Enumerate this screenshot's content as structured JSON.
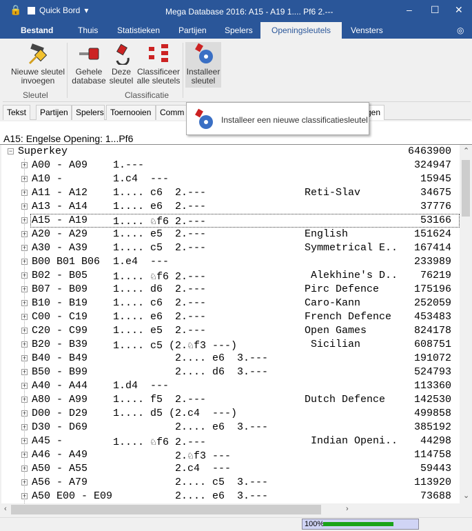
{
  "titlebar": {
    "quick_board": "Quick Bord",
    "title": "Mega Database 2016:  A15 - A19    1.... Pf6 2.---"
  },
  "ribbon_tabs": [
    "Bestand",
    "Thuis",
    "Statistieken",
    "Partijen",
    "Spelers",
    "Openingsleutels",
    "Vensters"
  ],
  "ribbon": {
    "new_key": "Nieuwe sleutel invoegen",
    "group_key": "Sleutel",
    "whole_db": "Gehele database",
    "this_key": "Deze sleutel",
    "classify_all": "Classificeer alle sleutels",
    "install_key": "Installeer sleutel",
    "group_class": "Classificatie"
  },
  "doc_tabs": [
    "Tekst",
    "Partijen",
    "Spelers",
    "Toernooien",
    "Comm",
    "gen"
  ],
  "tooltip": "Installeer een nieuwe classificatiesleutel",
  "heading": "A15: Engelse Opening: 1...Pf6",
  "tree": {
    "root": {
      "label": "Superkey",
      "count": "6463900"
    },
    "rows": [
      {
        "code": "A00 - A09",
        "moves": "1.---",
        "name": "",
        "count": "324947"
      },
      {
        "code": "A10 -",
        "moves": "1.c4  ---",
        "name": "",
        "count": "15945"
      },
      {
        "code": "A11 - A12",
        "moves": "1.... c6  2.---",
        "name": "Reti-Slav",
        "count": "34675"
      },
      {
        "code": "A13 - A14",
        "moves": "1.... e6  2.---",
        "name": "",
        "count": "37776"
      },
      {
        "code": "A15 - A19",
        "moves": "1.... ♘f6 2.---",
        "name": "",
        "count": "53166",
        "selected": true
      },
      {
        "code": "A20 - A29",
        "moves": "1.... e5  2.---",
        "name": "English",
        "count": "151624"
      },
      {
        "code": "A30 - A39",
        "moves": "1.... c5  2.---",
        "name": "Symmetrical E..",
        "count": "167414"
      },
      {
        "code": "B00 B01 B06",
        "moves": "1.e4  ---",
        "name": "",
        "count": "233989"
      },
      {
        "code": "B02 - B05",
        "moves": "1.... ♘f6 2.---",
        "name": " Alekhine's D..",
        "count": "76219"
      },
      {
        "code": "B07 - B09",
        "moves": "1.... d6  2.---",
        "name": "Pirc Defence",
        "count": "175196"
      },
      {
        "code": "B10 - B19",
        "moves": "1.... c6  2.---",
        "name": "Caro-Kann",
        "count": "252059"
      },
      {
        "code": "C00 - C19",
        "moves": "1.... e6  2.---",
        "name": "French Defence",
        "count": "453483"
      },
      {
        "code": "C20 - C99",
        "moves": "1.... e5  2.---",
        "name": "Open Games",
        "count": "824178"
      },
      {
        "code": "B20 - B39",
        "moves": "1.... c5 (2.♘f3 ---)",
        "name": " Sicilian",
        "count": "608751"
      },
      {
        "code": "B40 - B49",
        "moves": "          2.... e6  3.---",
        "name": "",
        "count": "191072"
      },
      {
        "code": "B50 - B99",
        "moves": "          2.... d6  3.---",
        "name": "",
        "count": "524793"
      },
      {
        "code": "A40 - A44",
        "moves": "1.d4  ---",
        "name": "",
        "count": "113360"
      },
      {
        "code": "A80 - A99",
        "moves": "1.... f5  2.---",
        "name": "Dutch Defence",
        "count": "142530"
      },
      {
        "code": "D00 - D29",
        "moves": "1.... d5 (2.c4  ---)",
        "name": "",
        "count": "499858"
      },
      {
        "code": "D30 - D69",
        "moves": "          2.... e6  3.---",
        "name": "",
        "count": "385192"
      },
      {
        "code": "A45 -",
        "moves": "1.... ♘f6 2.---",
        "name": " Indian Openi..",
        "count": "44298"
      },
      {
        "code": "A46 - A49",
        "moves": "          2.♘f3 ---",
        "name": "",
        "count": "114758"
      },
      {
        "code": "A50 - A55",
        "moves": "          2.c4  ---",
        "name": "",
        "count": "59443"
      },
      {
        "code": "A56 - A79",
        "moves": "          2.... c5  3.---",
        "name": "",
        "count": "113920"
      },
      {
        "code": "A50 E00 - E09",
        "moves": "          2.... e6  3.---",
        "name": "",
        "count": "73688"
      }
    ]
  },
  "status": {
    "progress_label": "100%",
    "progress": 1.0
  },
  "colors": {
    "accent": "#2a5699",
    "progress": "#1aa31a"
  }
}
